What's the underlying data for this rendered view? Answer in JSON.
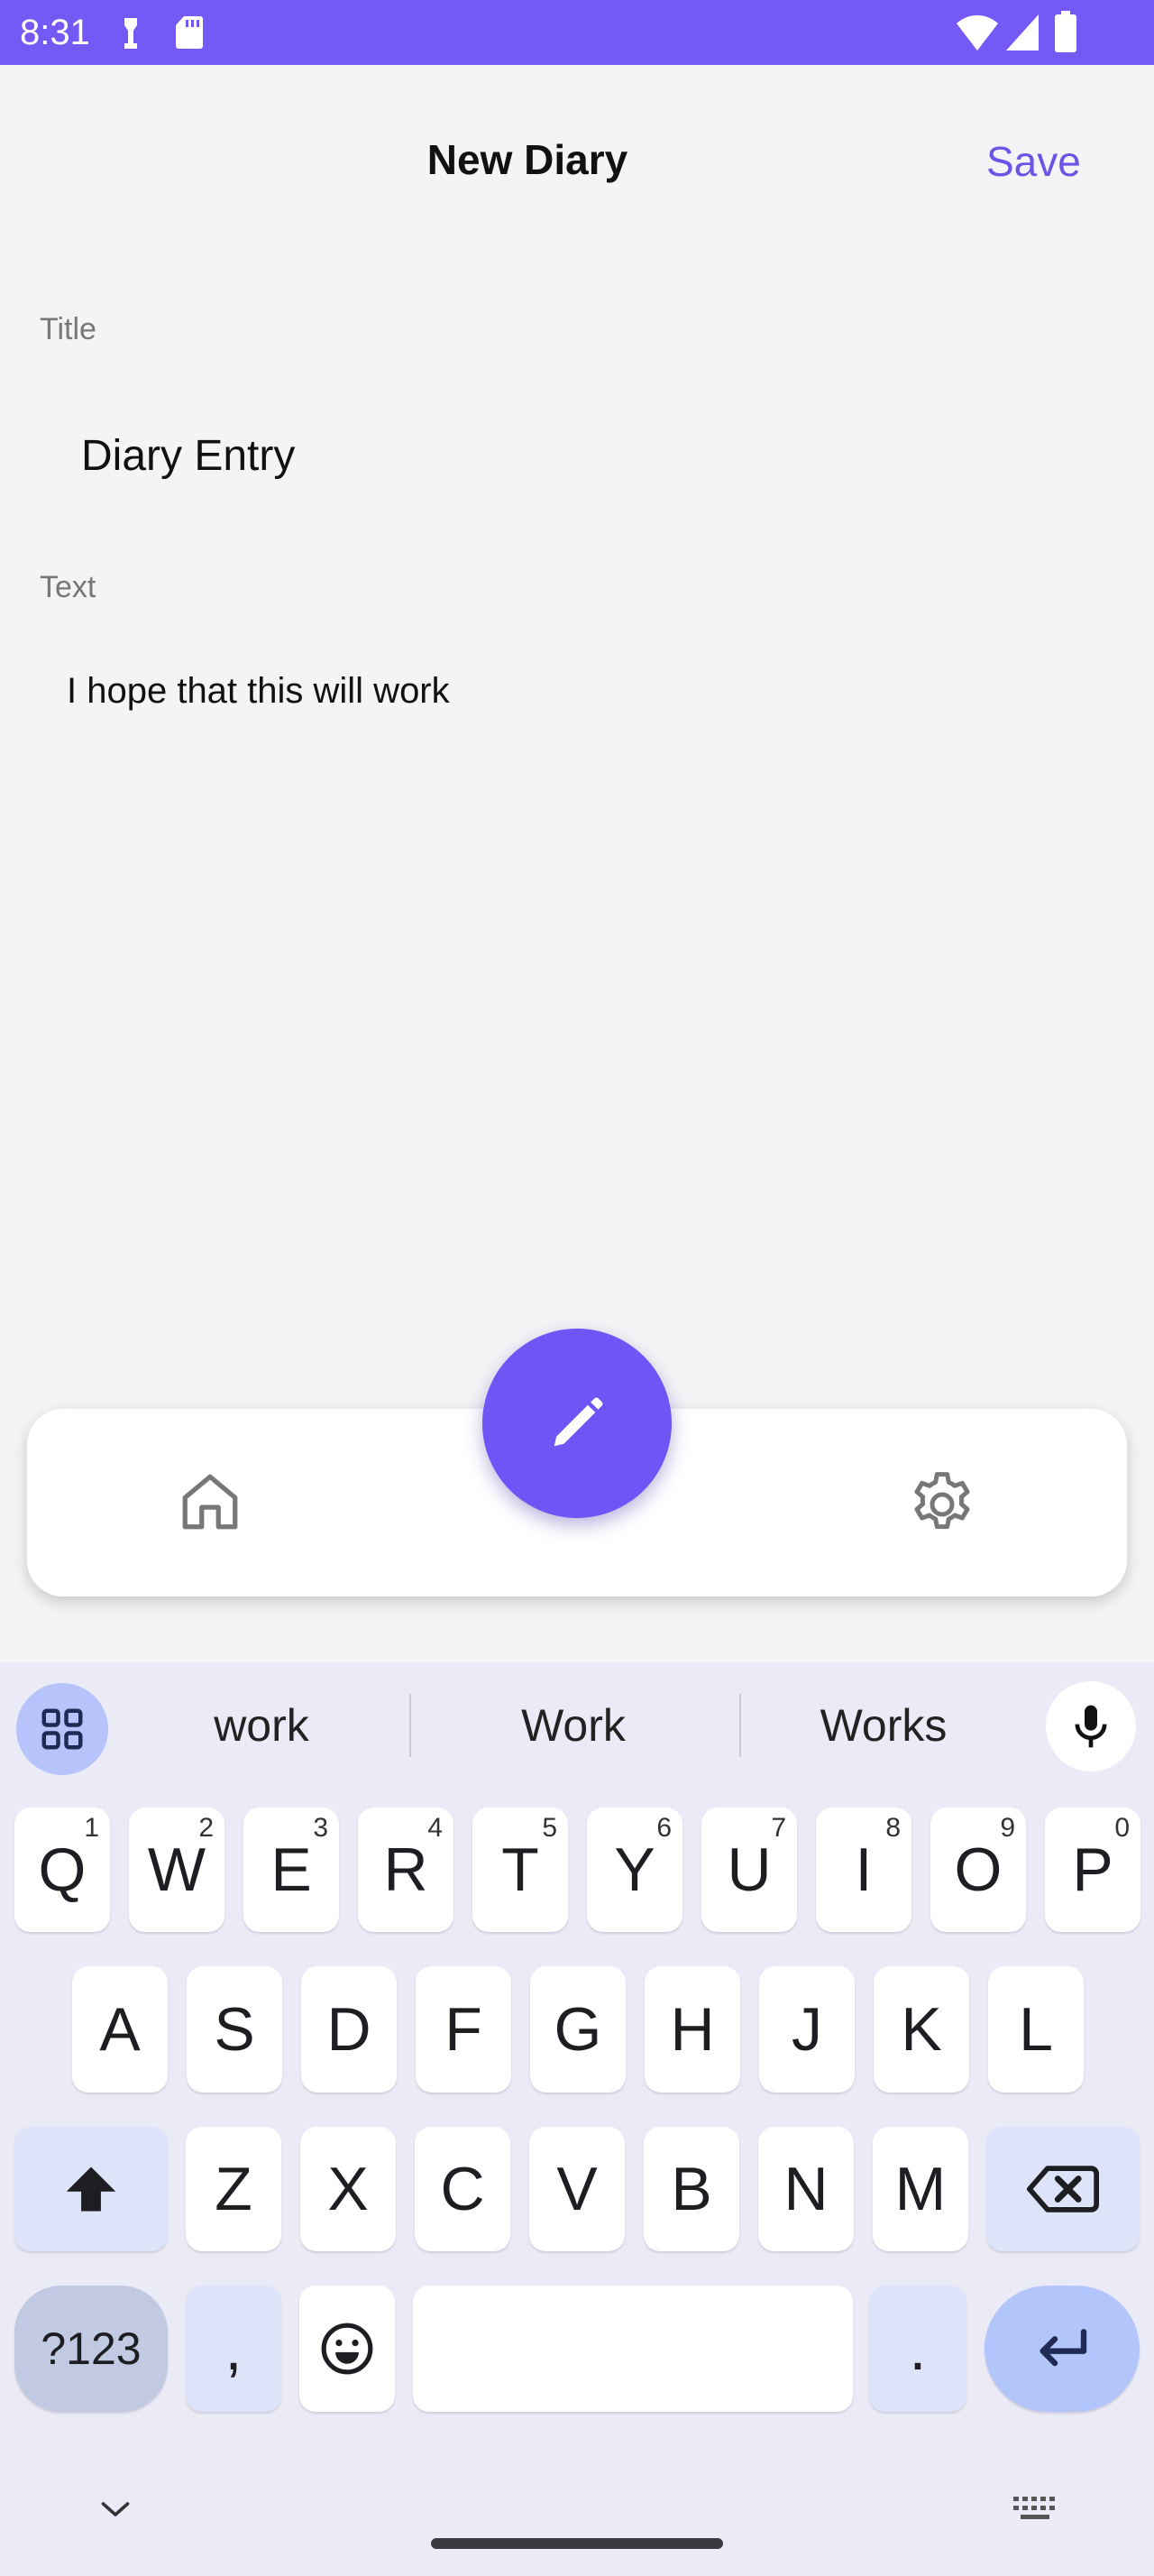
{
  "status_bar": {
    "time": "8:31"
  },
  "header": {
    "title": "New Diary",
    "save_label": "Save"
  },
  "form": {
    "title_label": "Title",
    "title_value": "Diary Entry",
    "text_label": "Text",
    "text_value": "I hope that this will work"
  },
  "colors": {
    "accent": "#7459f5",
    "fab": "#6e55f5",
    "save": "#6a55e8"
  },
  "keyboard": {
    "suggestions": [
      "work",
      "Work",
      "Works"
    ],
    "row1": [
      {
        "k": "Q",
        "n": "1"
      },
      {
        "k": "W",
        "n": "2"
      },
      {
        "k": "E",
        "n": "3"
      },
      {
        "k": "R",
        "n": "4"
      },
      {
        "k": "T",
        "n": "5"
      },
      {
        "k": "Y",
        "n": "6"
      },
      {
        "k": "U",
        "n": "7"
      },
      {
        "k": "I",
        "n": "8"
      },
      {
        "k": "O",
        "n": "9"
      },
      {
        "k": "P",
        "n": "0"
      }
    ],
    "row2": [
      "A",
      "S",
      "D",
      "F",
      "G",
      "H",
      "J",
      "K",
      "L"
    ],
    "row3": [
      "Z",
      "X",
      "C",
      "V",
      "B",
      "N",
      "M"
    ],
    "sym_label": "?123",
    "comma": ",",
    "period": "."
  }
}
